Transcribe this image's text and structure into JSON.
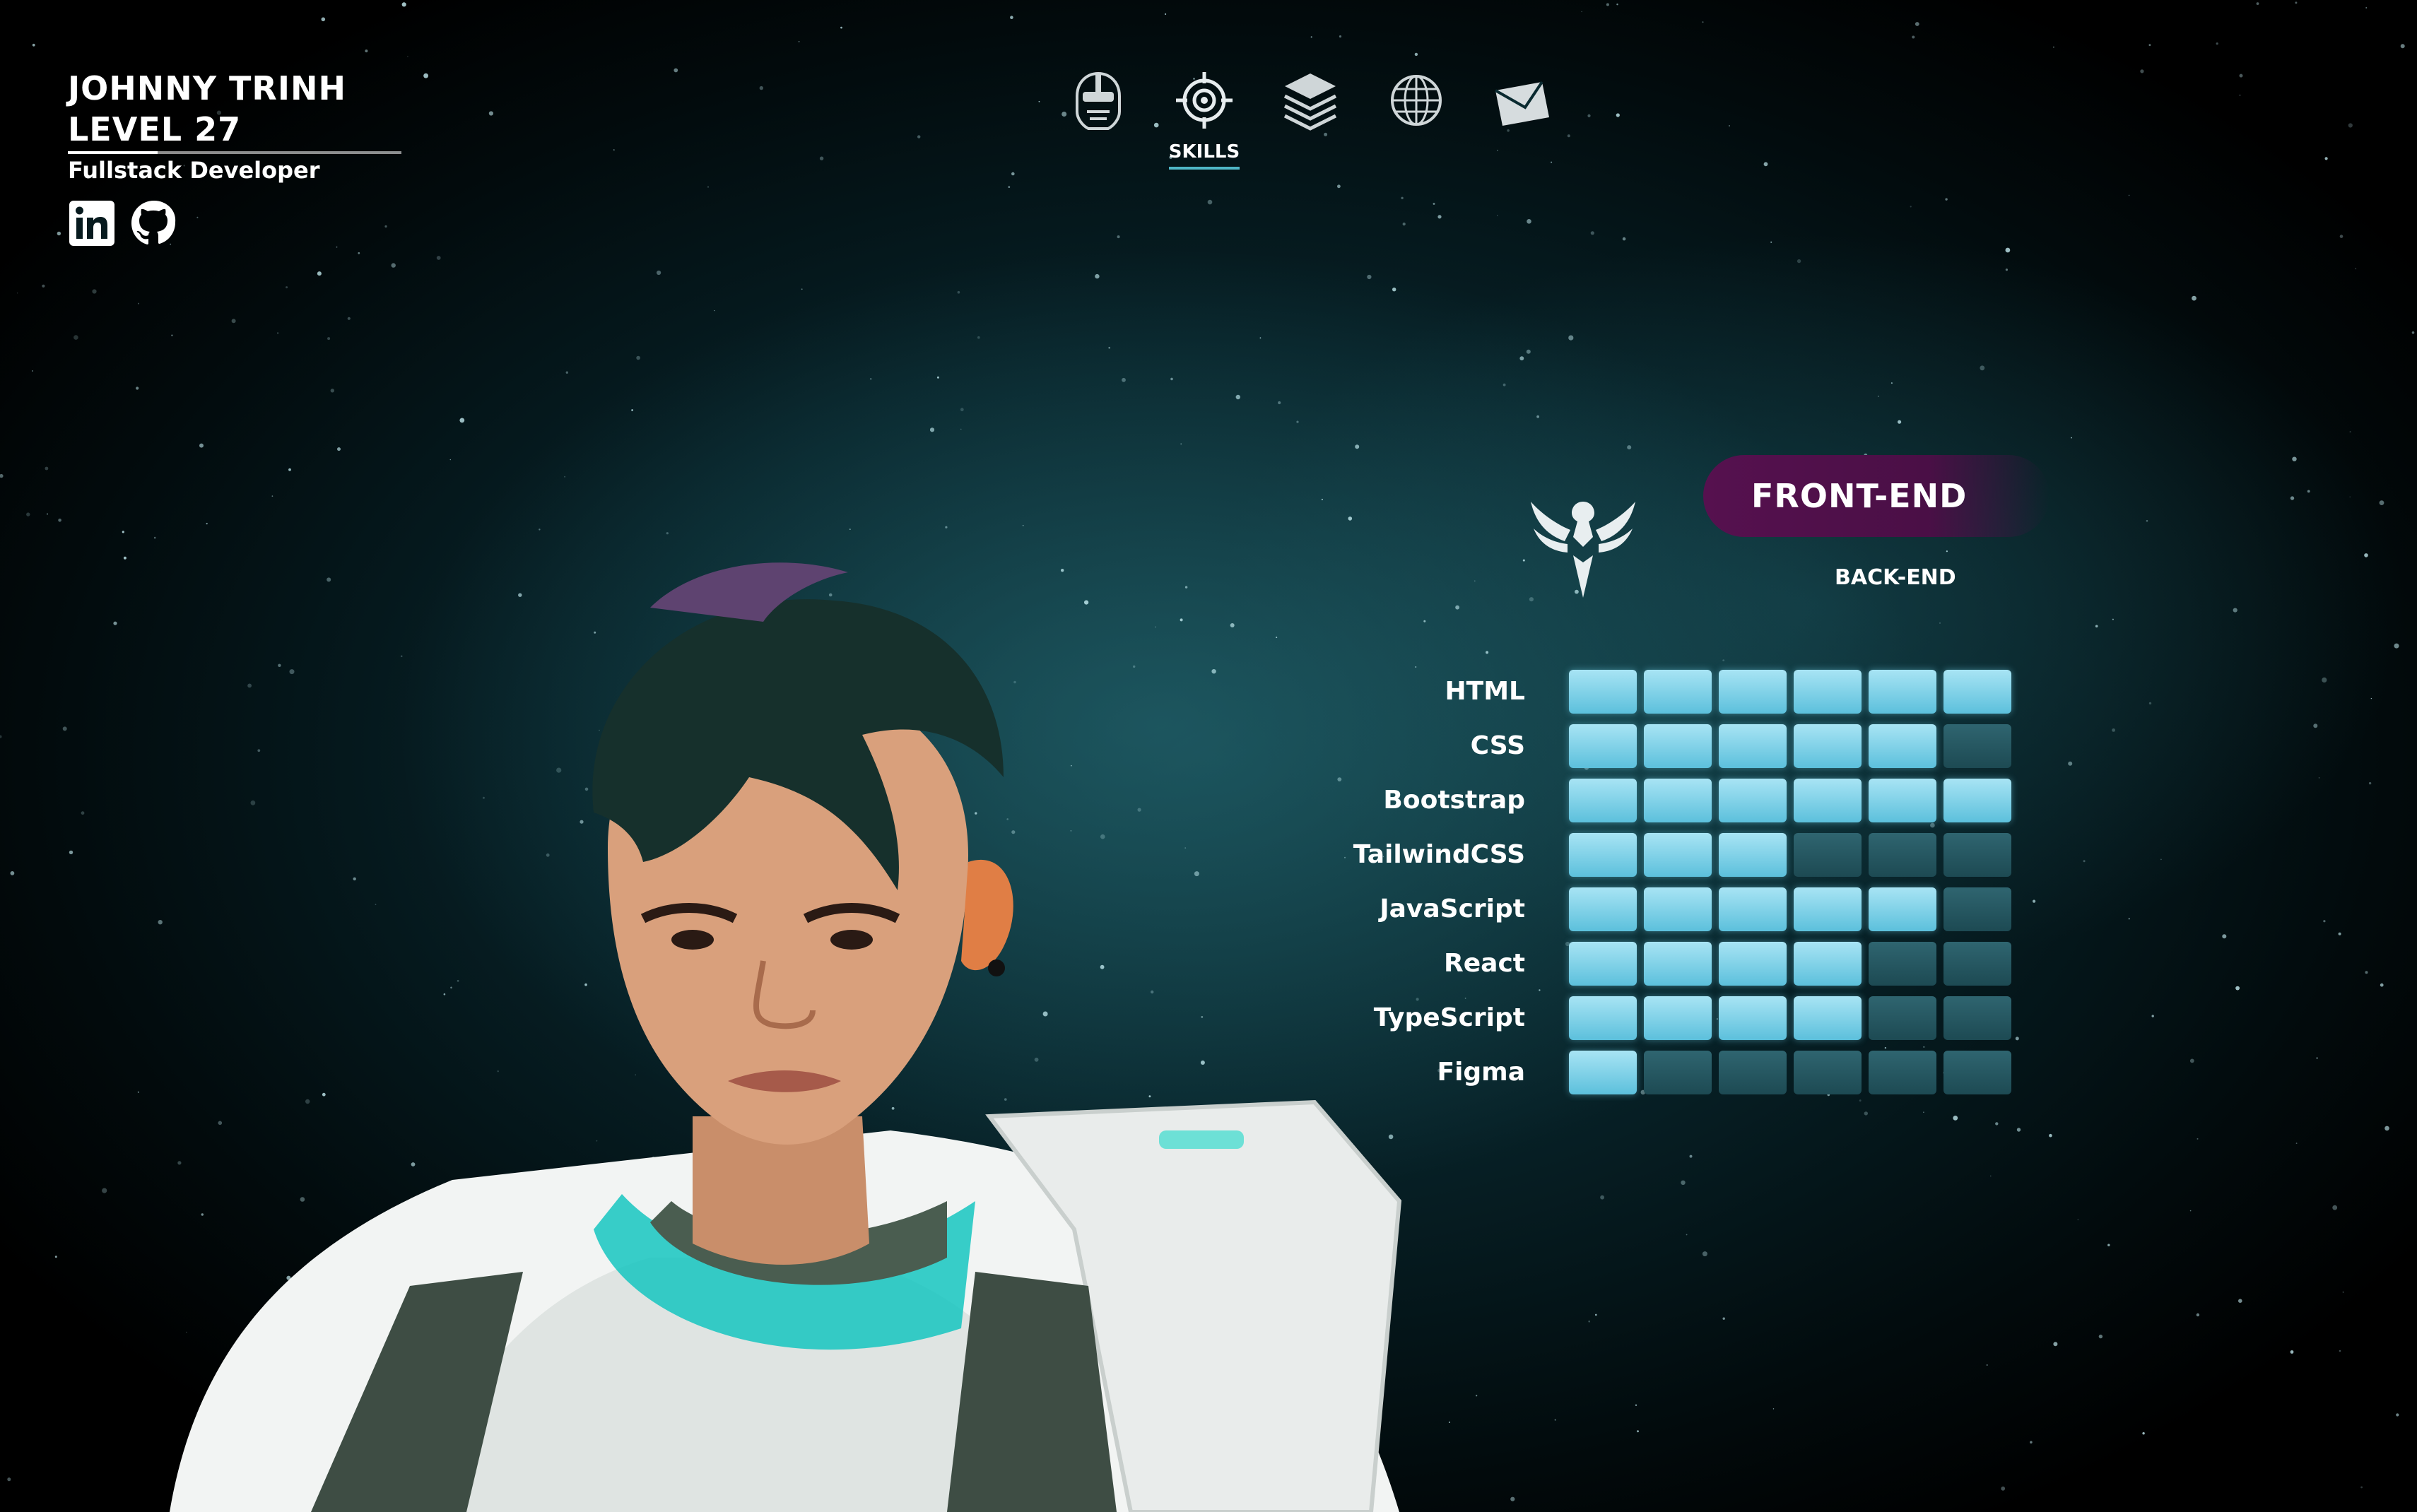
{
  "profile": {
    "name": "JOHNNY TRINH",
    "level": "LEVEL 27",
    "role": "Fullstack Developer",
    "xp_progress": 0.27,
    "socials": [
      {
        "name": "linkedin-icon"
      },
      {
        "name": "github-icon"
      }
    ]
  },
  "nav": {
    "items": [
      {
        "icon": "helmet-icon",
        "label": ""
      },
      {
        "icon": "target-icon",
        "label": "SKILLS",
        "active": true
      },
      {
        "icon": "layers-icon",
        "label": ""
      },
      {
        "icon": "globe-icon",
        "label": ""
      },
      {
        "icon": "envelope-icon",
        "label": ""
      }
    ]
  },
  "skills": {
    "emblem": "phoenix-emblem-icon",
    "tabs": {
      "active": "FRONT-END",
      "inactive": "BACK-END"
    },
    "max_level": 6,
    "items": [
      {
        "label": "HTML",
        "level": 6
      },
      {
        "label": "CSS",
        "level": 5
      },
      {
        "label": "Bootstrap",
        "level": 6
      },
      {
        "label": "TailwindCSS",
        "level": 3
      },
      {
        "label": "JavaScript",
        "level": 5
      },
      {
        "label": "React",
        "level": 4
      },
      {
        "label": "TypeScript",
        "level": 4
      },
      {
        "label": "Figma",
        "level": 1
      }
    ]
  },
  "colors": {
    "accent": "#4fb6c6",
    "tab_active": "#56114f",
    "cell_on": "#7fd3ea",
    "cell_off": "#255660"
  }
}
